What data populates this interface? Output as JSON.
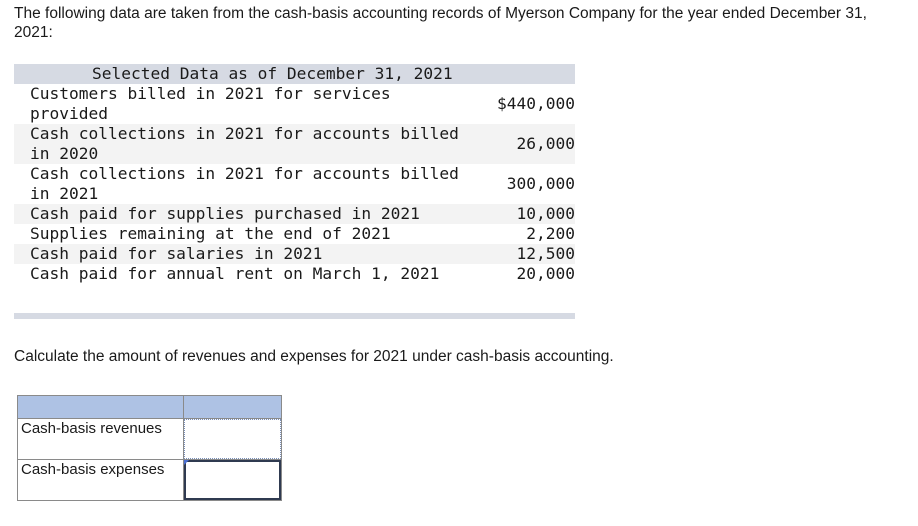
{
  "intro_text": "The following data are taken from the cash-basis accounting records of Myerson Company for the year ended December 31, 2021:",
  "data_table": {
    "header": "Selected Data as of December 31, 2021",
    "rows": [
      {
        "label": "Customers billed in 2021 for services provided",
        "value": "$440,000"
      },
      {
        "label": "Cash collections in 2021 for accounts billed in 2020",
        "value": "26,000"
      },
      {
        "label": "Cash collections in 2021 for accounts billed in 2021",
        "value": "300,000"
      },
      {
        "label": "Cash paid for supplies purchased in 2021",
        "value": "10,000"
      },
      {
        "label": "Supplies remaining at the end of 2021",
        "value": "2,200"
      },
      {
        "label": "Cash paid for salaries in 2021",
        "value": "12,500"
      },
      {
        "label": "Cash paid for annual rent on March 1, 2021",
        "value": "20,000"
      }
    ]
  },
  "question_text": "Calculate the amount of revenues and expenses for 2021 under cash-basis accounting.",
  "answer_table": {
    "rows": [
      {
        "label": "Cash-basis revenues",
        "value": ""
      },
      {
        "label": "Cash-basis expenses",
        "value": ""
      }
    ]
  },
  "colors": {
    "header_fill": "#d6dae3",
    "answer_header_fill": "#aec2e4",
    "stripe_fill": "#f3f3f3"
  }
}
